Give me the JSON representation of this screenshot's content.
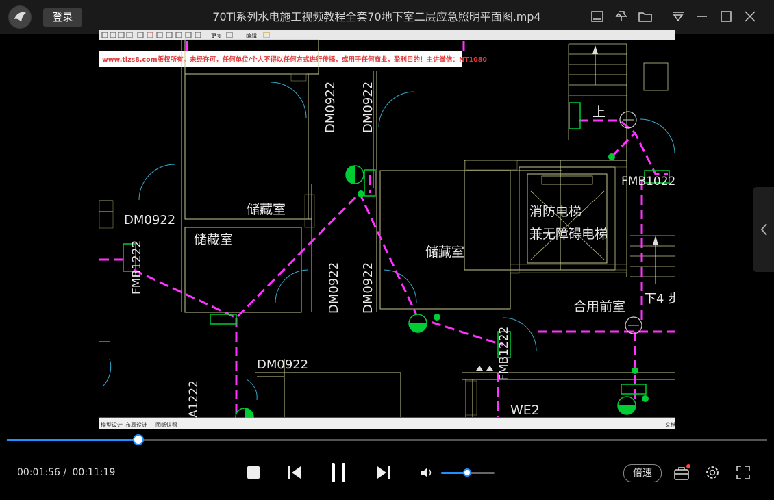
{
  "titlebar": {
    "login_label": "登录",
    "title": "70Ti系列水电施工视频教程全套70地下室二层应急照明平面图.mp4",
    "icons": [
      "app-logo-icon",
      "mini-mode-icon",
      "pin-icon",
      "folder-icon",
      "playlist-menu-icon",
      "minimize-icon",
      "maximize-icon",
      "close-icon"
    ]
  },
  "video_frame": {
    "watermark": "www.tlzs8.com版权所有，未经许可，任何单位/个人不得以任何方式进行传播，或用于任何商业，盈利目的！主讲微信：NT1080",
    "toolbar_labels": [
      "更多",
      "编辑"
    ],
    "labels": {
      "door_dm0922": "DM0922",
      "door_fmb1222": "FMB1222",
      "door_fmb1022": "FMB1022",
      "storage": "储藏室",
      "fire_elevator": "消防电梯",
      "accessible_elevator": "兼无障碍电梯",
      "front_room": "合用前室",
      "up": "上",
      "down_steps": "下4 步",
      "we2": "WE2",
      "a1222": "A1222"
    },
    "status_tabs": [
      "模型设计",
      "布局设计",
      "图纸快照"
    ],
    "right_status": "文档"
  },
  "playback": {
    "current_time": "00:01:56",
    "separator": "/",
    "total_time": "00:11:19",
    "progress": 0.173,
    "volume": 0.49,
    "state": "playing"
  },
  "controls": {
    "speed_label": "倍速",
    "icons": [
      "stop-icon",
      "previous-icon",
      "pause-icon",
      "next-icon",
      "volume-icon",
      "toolbox-icon",
      "settings-icon",
      "fullscreen-icon"
    ]
  },
  "colors": {
    "accent": "#1e90ff",
    "cad_wall": "#c8c890",
    "cad_route": "#ff33ff",
    "cad_fixture": "#00cc33",
    "cad_door": "#33aacc"
  }
}
